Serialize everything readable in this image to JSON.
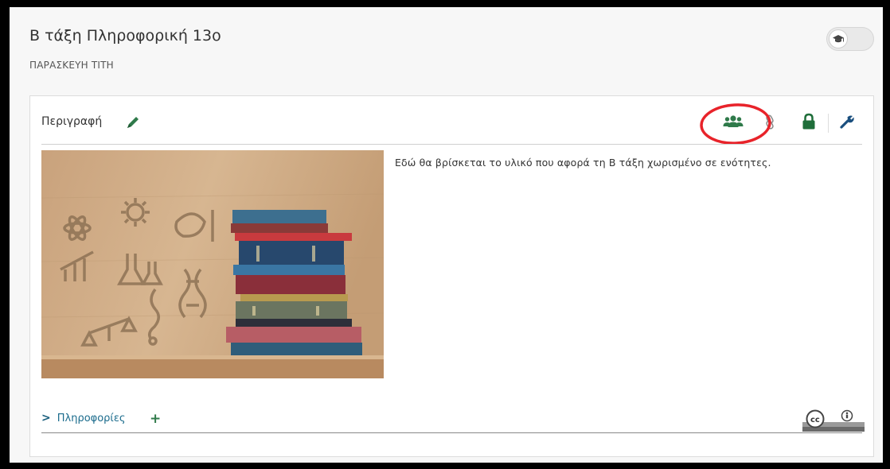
{
  "course": {
    "title": "Β τάξη Πληροφορική 13ο",
    "teacher": "ΠΑΡΑΣΚΕΥΗ ΤΙΤΗ"
  },
  "panel": {
    "title": "Περιγραφή",
    "description": "Εδώ θα βρίσκεται το υλικό που αφορά τη Β τάξη χωρισμένο σε ενότητες.",
    "info_label": "Πληροφορίες"
  },
  "icons": {
    "edit": "pencil-icon",
    "users": "users-icon",
    "link": "link-icon",
    "lock": "lock-icon",
    "settings": "wrench-icon",
    "student_view": "graduation-cap-icon",
    "expand": "chevron-right-icon",
    "add": "plus-icon",
    "license": "creative-commons-icon"
  },
  "colors": {
    "accent_green": "#2f7a4a",
    "dark_blue": "#1a4f7e",
    "highlight_red": "#e8232a",
    "lock_green": "#1f6e3a"
  }
}
